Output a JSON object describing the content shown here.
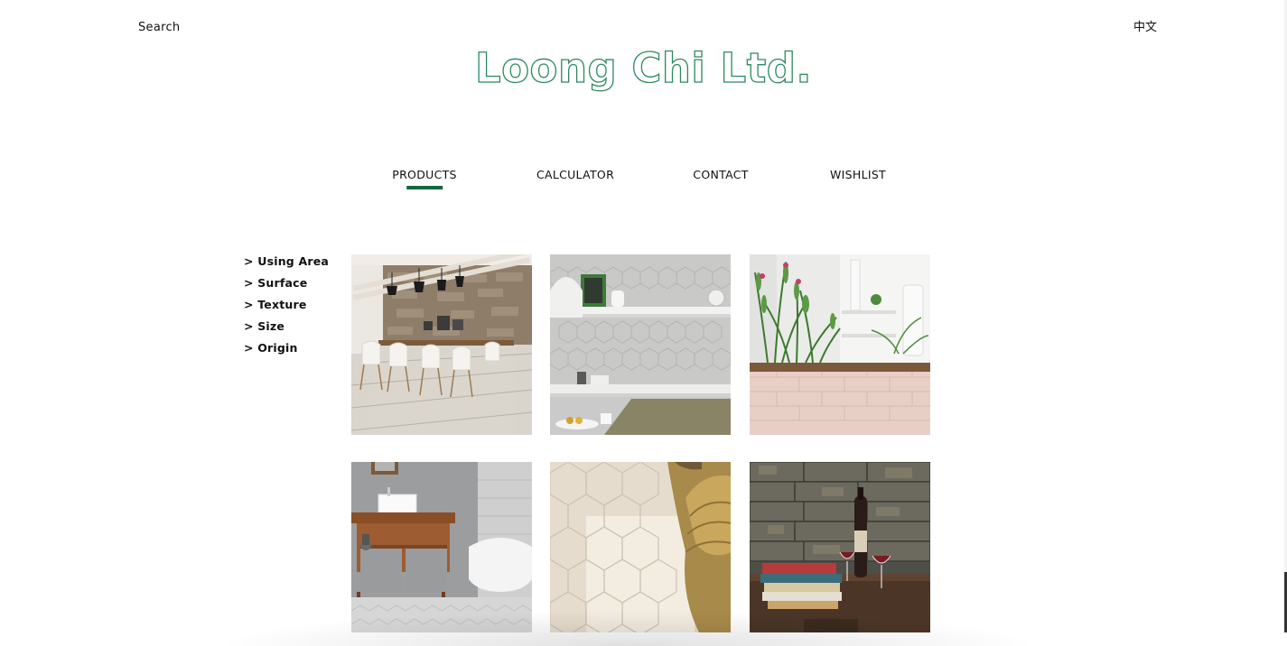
{
  "header": {
    "search_label": "Search",
    "language_label": "中文",
    "brand": "Loong Chi Ltd.",
    "brand_color": "#2b8a5e"
  },
  "nav": {
    "items": [
      {
        "label": "PRODUCTS",
        "active": true
      },
      {
        "label": "CALCULATOR",
        "active": false
      },
      {
        "label": "CONTACT",
        "active": false
      },
      {
        "label": "WISHLIST",
        "active": false
      }
    ],
    "active_color": "#12683d"
  },
  "filters": [
    "> Using Area",
    "> Surface",
    "> Texture",
    "> Size",
    "> Origin"
  ],
  "products": [
    {
      "icon": "dining-room-image"
    },
    {
      "icon": "kitchen-shelves-hexagon-tile-image"
    },
    {
      "icon": "planter-subway-tile-image"
    },
    {
      "icon": "bathroom-vanity-image"
    },
    {
      "icon": "hexagon-floor-tile-image"
    },
    {
      "icon": "rustic-brick-wine-image"
    }
  ]
}
